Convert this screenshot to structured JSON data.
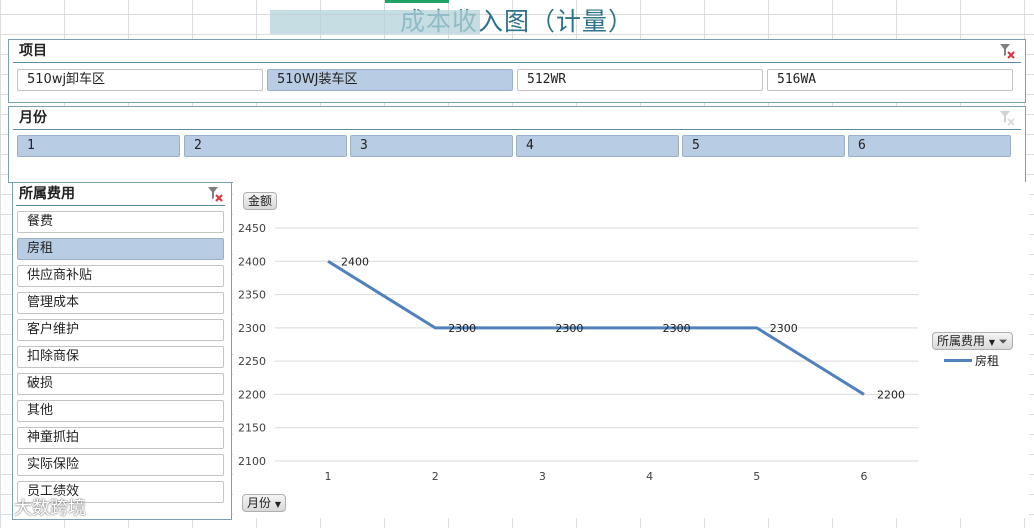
{
  "title": "成本收入图（计量）",
  "slicers": {
    "project": {
      "header": "项目",
      "items": [
        {
          "label": "510wj卸车区",
          "selected": false
        },
        {
          "label": "510WJ装车区",
          "selected": true
        },
        {
          "label": "512WR",
          "selected": false
        },
        {
          "label": "516WA",
          "selected": false
        }
      ]
    },
    "month": {
      "header": "月份",
      "items": [
        {
          "label": "1",
          "selected": true
        },
        {
          "label": "2",
          "selected": true
        },
        {
          "label": "3",
          "selected": true
        },
        {
          "label": "4",
          "selected": true
        },
        {
          "label": "5",
          "selected": true
        },
        {
          "label": "6",
          "selected": true
        }
      ]
    },
    "expense": {
      "header": "所属费用",
      "items": [
        {
          "label": "餐费",
          "selected": false
        },
        {
          "label": "房租",
          "selected": true
        },
        {
          "label": "供应商补贴",
          "selected": false
        },
        {
          "label": "管理成本",
          "selected": false
        },
        {
          "label": "客户维护",
          "selected": false
        },
        {
          "label": "扣除商保",
          "selected": false
        },
        {
          "label": "破损",
          "selected": false
        },
        {
          "label": "其他",
          "selected": false
        },
        {
          "label": "神童抓拍",
          "selected": false
        },
        {
          "label": "实际保险",
          "selected": false
        },
        {
          "label": "员工绩效",
          "selected": false
        }
      ]
    }
  },
  "chart_buttons": {
    "value_field": "金额",
    "axis_field": "月份",
    "legend_field": "所属费用"
  },
  "chart_data": {
    "type": "line",
    "categories": [
      "1",
      "2",
      "3",
      "4",
      "5",
      "6"
    ],
    "series": [
      {
        "name": "房租",
        "values": [
          2400,
          2300,
          2300,
          2300,
          2300,
          2200
        ],
        "color": "#4f81bd"
      }
    ],
    "ylim": [
      2100,
      2450
    ],
    "yticks": [
      2100,
      2150,
      2200,
      2250,
      2300,
      2350,
      2400,
      2450
    ],
    "data_labels": [
      "2400",
      "2300",
      "2300",
      "2300",
      "2300",
      "2200"
    ],
    "grid": true,
    "legend": "right"
  },
  "watermark": "大数跨境"
}
